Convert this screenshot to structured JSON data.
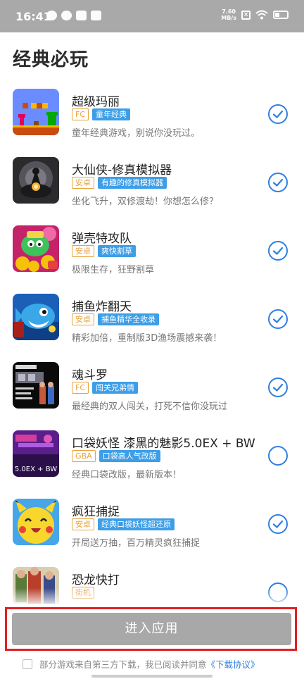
{
  "status_bar": {
    "time": "16:41",
    "speed_value": "7.60",
    "speed_unit": "MB/s"
  },
  "page": {
    "title": "经典必玩"
  },
  "games": [
    {
      "name": "超级玛丽",
      "platform": "FC",
      "feature": "童年经典",
      "desc": "童年经典游戏，别说你没玩过。",
      "selected": true,
      "icon": "mario-thumbnail"
    },
    {
      "name": "大仙侠-修真模拟器",
      "platform": "安卓",
      "feature": "有趣的修真模拟器",
      "desc": "坐化飞升，双修渡劫！你想怎么修？",
      "selected": true,
      "icon": "cultivation-thumbnail"
    },
    {
      "name": "弹壳特攻队",
      "platform": "安卓",
      "feature": "爽快割草",
      "desc": "极限生存，狂野割草",
      "selected": true,
      "icon": "dinosaur-thumbnail"
    },
    {
      "name": "捕鱼炸翻天",
      "platform": "安卓",
      "feature": "捕鱼精华全收录",
      "desc": "精彩加倍，重制版3D渔场震撼来袭！",
      "selected": true,
      "icon": "fish-thumbnail"
    },
    {
      "name": "魂斗罗",
      "platform": "FC",
      "feature": "闯关兄弟情",
      "desc": "最经典的双人闯关，打死不信你没玩过",
      "selected": true,
      "icon": "contra-thumbnail"
    },
    {
      "name": "口袋妖怪 漆黑的魅影5.0EX + BW",
      "platform": "GBA",
      "feature": "口袋高人气改版",
      "desc": "经典口袋改版，最新版本！",
      "selected": false,
      "icon": "pokemon-thumbnail",
      "thumb_text": "5.0EX + BW"
    },
    {
      "name": "疯狂捕捉",
      "platform": "安卓",
      "feature": "经典口袋妖怪超还原",
      "desc": "开局送万抽，百万精灵疯狂捕捉",
      "selected": true,
      "icon": "pikachu-thumbnail"
    },
    {
      "name": "恐龙快打",
      "platform": "街机",
      "feature": "",
      "desc": "",
      "selected": false,
      "icon": "brawler-thumbnail"
    }
  ],
  "footer": {
    "enter_label": "进入应用",
    "agree_text": "部分游戏来自第三方下载，我已阅读并同意",
    "agree_link": "《下载协议》"
  },
  "colors": {
    "accent": "#2f7fe0",
    "platform_tag": "#e8a33d",
    "feature_tag": "#3d9ee8",
    "button_disabled": "#a8a8a8"
  }
}
